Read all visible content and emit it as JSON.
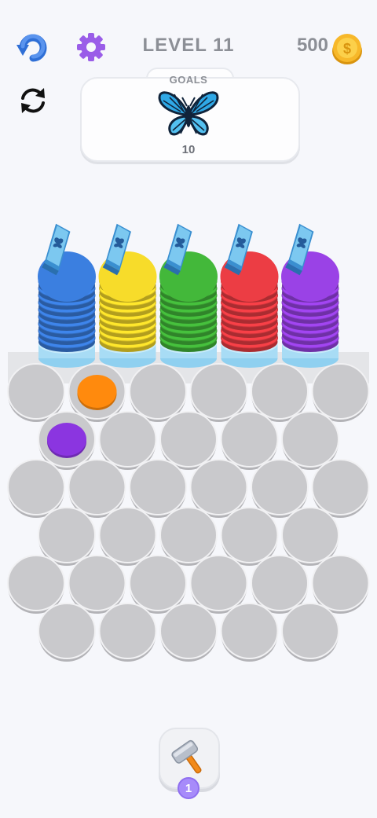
{
  "header": {
    "level_label": "LEVEL 11",
    "coins": "500",
    "undo_icon": "undo-arrow-icon",
    "settings_icon": "gear-icon",
    "restart_icon": "refresh-icon",
    "coin_icon": "coin-icon"
  },
  "goals": {
    "label": "GOALS",
    "goal_icon": "butterfly-icon",
    "count": "10"
  },
  "stacks": [
    {
      "color_name": "blue",
      "color": "#3b7fe0",
      "disks": 9,
      "card_icon": "butterfly-card-icon"
    },
    {
      "color_name": "yellow",
      "color": "#f7dc2a",
      "disks": 9,
      "card_icon": "butterfly-card-icon"
    },
    {
      "color_name": "green",
      "color": "#43b83a",
      "disks": 9,
      "card_icon": "butterfly-card-icon"
    },
    {
      "color_name": "red",
      "color": "#ec3d44",
      "disks": 9,
      "card_icon": "butterfly-card-icon"
    },
    {
      "color_name": "purple",
      "color": "#9a42e6",
      "disks": 9,
      "card_icon": "butterfly-card-icon"
    }
  ],
  "board": {
    "rows": [
      6,
      5,
      6,
      5,
      6,
      5
    ],
    "occupied": [
      {
        "row": 0,
        "col": 1,
        "color": "#ff8a0d",
        "color_name": "orange"
      },
      {
        "row": 1,
        "col": 0,
        "color": "#8b35e0",
        "color_name": "purple"
      }
    ],
    "empty_cell_color": "#c9c9cc"
  },
  "booster": {
    "icon": "hammer-icon",
    "count": "1"
  }
}
